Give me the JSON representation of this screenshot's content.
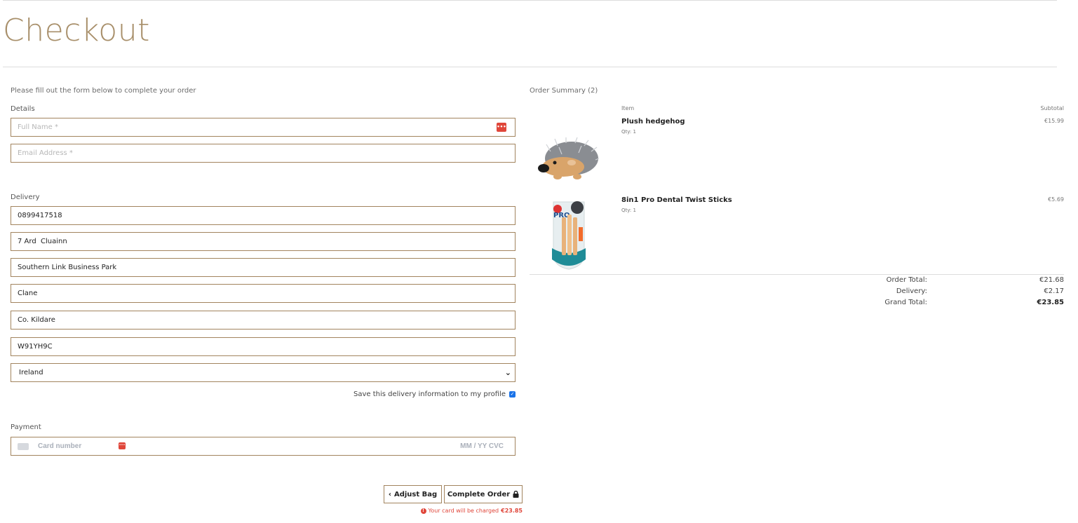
{
  "page": {
    "title": "Checkout"
  },
  "form": {
    "intro": "Please fill out the form below to complete your order",
    "details_label": "Details",
    "full_name_placeholder": "Full Name *",
    "email_placeholder": "Email Address *",
    "delivery_label": "Delivery",
    "phone": "0899417518",
    "street1": "7 Ard  Cluainn",
    "street2": "Southern Link Business Park",
    "town": "Clane",
    "county": "Co. Kildare",
    "postcode": "W91YH9C",
    "country": "Ireland",
    "save_info_label": "Save this delivery information to my profile",
    "save_info_checked": true,
    "payment_label": "Payment",
    "card_placeholder": "Card number",
    "card_exp_cvc_placeholder": "MM / YY  CVC"
  },
  "actions": {
    "adjust_bag": "Adjust Bag",
    "complete_order": "Complete Order",
    "charge_note": "Your card will be charged",
    "charge_amount": "€23.85"
  },
  "summary": {
    "title": "Order Summary (2)",
    "col_item": "Item",
    "col_subtotal": "Subtotal",
    "items": [
      {
        "name": "Plush hedgehog",
        "qty": "Qty: 1",
        "subtotal": "€15.99",
        "image_icon": "hedgehog-toy"
      },
      {
        "name": "8in1 Pro Dental Twist Sticks",
        "qty": "Qty: 1",
        "subtotal": "€5.69",
        "image_icon": "dental-sticks-pack"
      }
    ],
    "order_total_label": "Order Total:",
    "order_total": "€21.68",
    "delivery_label": "Delivery:",
    "delivery": "€2.17",
    "grand_total_label": "Grand Total:",
    "grand_total": "€23.85"
  },
  "colors": {
    "accent": "#a88f6a",
    "border": "#a2845e",
    "alert": "#e0463a"
  }
}
